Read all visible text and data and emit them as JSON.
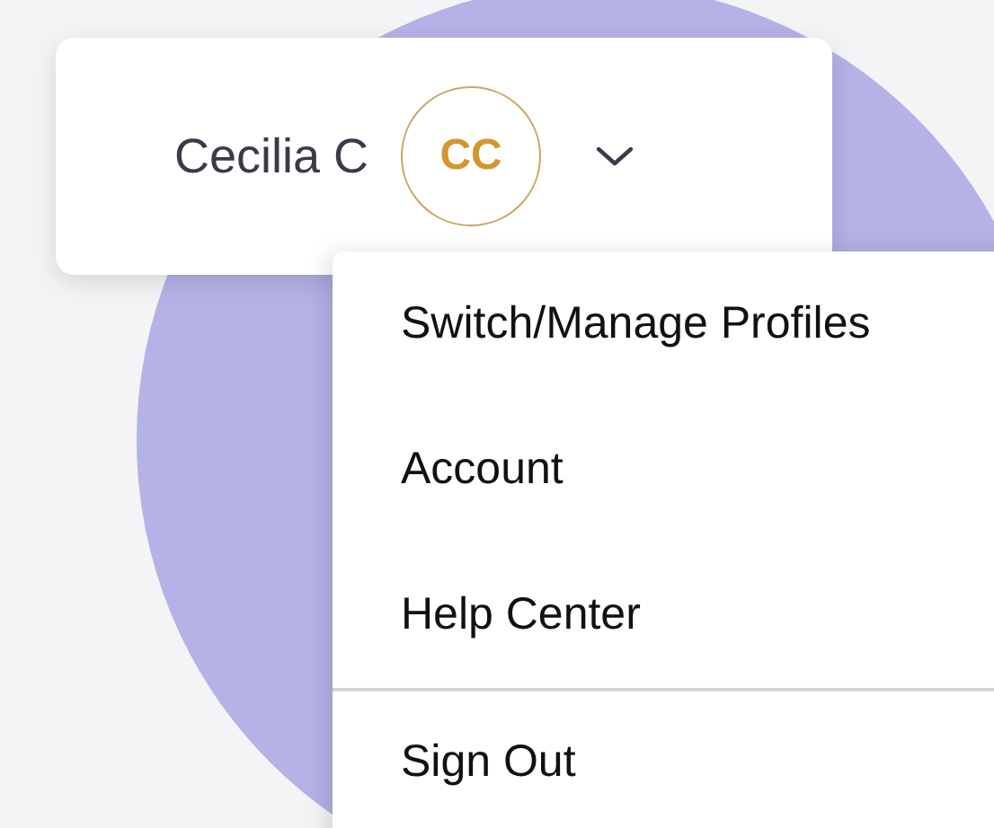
{
  "user": {
    "name": "Cecilia C",
    "initials": "CC"
  },
  "menu": {
    "items": [
      {
        "label": "Switch/Manage Profiles",
        "separated": false
      },
      {
        "label": "Account",
        "separated": false
      },
      {
        "label": "Help Center",
        "separated": false
      },
      {
        "label": "Sign Out",
        "separated": true
      }
    ]
  }
}
